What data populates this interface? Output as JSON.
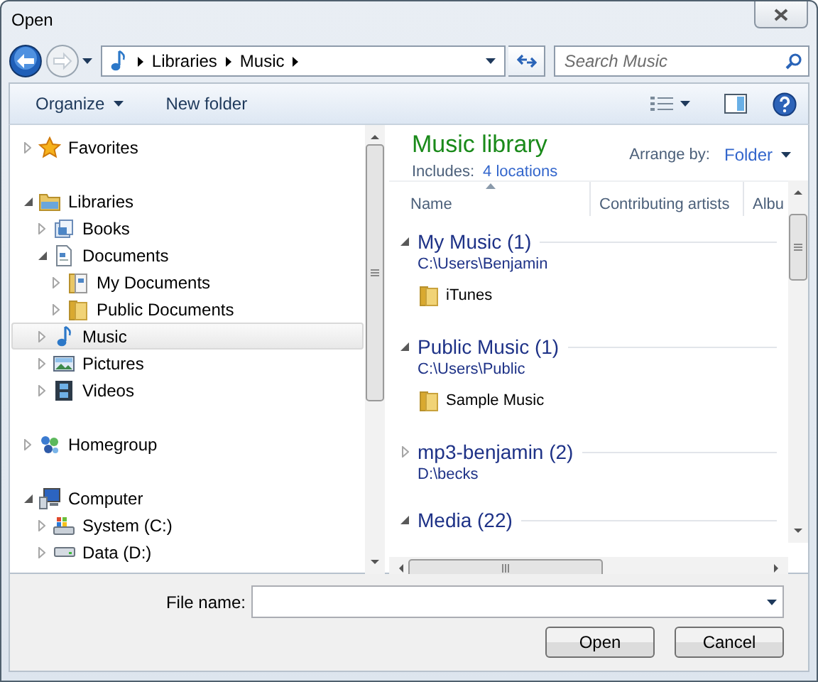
{
  "window": {
    "title": "Open"
  },
  "navigation": {
    "breadcrumbs": [
      "Libraries",
      "Music"
    ],
    "search": {
      "placeholder": "Search Music"
    }
  },
  "toolbar": {
    "buttons": [
      {
        "label": "Organize",
        "dropdown": true
      },
      {
        "label": "New folder",
        "dropdown": false
      }
    ]
  },
  "sidebar": {
    "nodes": [
      {
        "label": "Favorites",
        "kind": "favorites",
        "expanded": false,
        "selected": false
      },
      {
        "label": "Libraries",
        "kind": "library",
        "expanded": true,
        "selected": false,
        "children": [
          {
            "label": "Books",
            "kind": "books",
            "expanded": false,
            "selected": false
          },
          {
            "label": "Documents",
            "kind": "documents",
            "expanded": true,
            "selected": false,
            "children": [
              {
                "label": "My Documents",
                "kind": "document-folder",
                "expanded": false,
                "selected": false
              },
              {
                "label": "Public Documents",
                "kind": "folder",
                "expanded": false,
                "selected": false
              }
            ]
          },
          {
            "label": "Music",
            "kind": "music",
            "expanded": false,
            "selected": true
          },
          {
            "label": "Pictures",
            "kind": "pictures",
            "expanded": false,
            "selected": false
          },
          {
            "label": "Videos",
            "kind": "videos",
            "expanded": false,
            "selected": false
          }
        ]
      },
      {
        "label": "Homegroup",
        "kind": "homegroup",
        "expanded": false,
        "selected": false
      },
      {
        "label": "Computer",
        "kind": "computer",
        "expanded": true,
        "selected": false,
        "children": [
          {
            "label": "System (C:)",
            "kind": "system-drive",
            "expanded": false,
            "selected": false
          },
          {
            "label": "Data (D:)",
            "kind": "drive",
            "expanded": false,
            "selected": false
          }
        ]
      }
    ]
  },
  "library": {
    "title": "Music library",
    "includes_label": "Includes:",
    "includes_link": "4 locations",
    "arrange_label": "Arrange by:",
    "arrange_value": "Folder",
    "columns": [
      {
        "label": "Name",
        "sorted": true
      },
      {
        "label": "Contributing artists",
        "sorted": false
      },
      {
        "label": "Albu",
        "sorted": false
      }
    ],
    "groups": [
      {
        "title": "My Music (1)",
        "path": "C:\\Users\\Benjamin",
        "expanded": true,
        "items": [
          "iTunes"
        ]
      },
      {
        "title": "Public Music (1)",
        "path": "C:\\Users\\Public",
        "expanded": true,
        "items": [
          "Sample Music"
        ]
      },
      {
        "title": "mp3-benjamin (2)",
        "path": "D:\\becks",
        "expanded": false
      },
      {
        "title": "Media (22)",
        "expanded": true
      }
    ]
  },
  "footer": {
    "file_name_label": "File name:",
    "buttons": [
      "Open",
      "Cancel"
    ]
  }
}
